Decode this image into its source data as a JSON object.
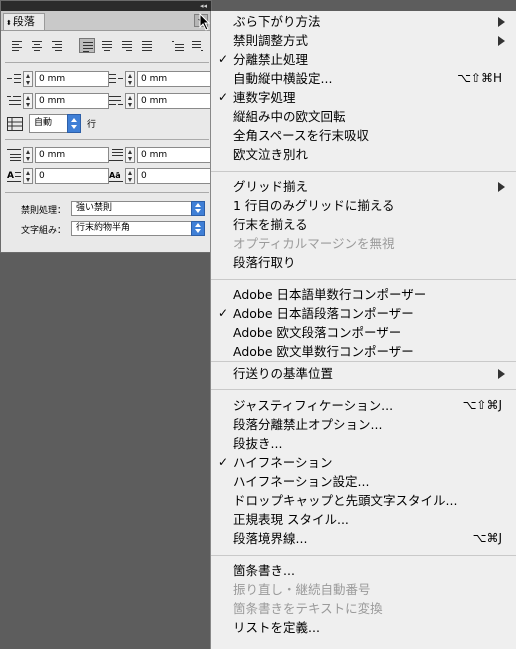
{
  "panel": {
    "tab_label": "段落",
    "fields": {
      "left_indent": "0 mm",
      "right_indent": "0 mm",
      "first_line_indent": "0 mm",
      "last_line_indent": "0 mm",
      "space_before": "0 mm",
      "space_after": "0 mm",
      "drop_cap_lines": "0",
      "drop_cap_chars": "0"
    },
    "auto_value": "自動",
    "auto_unit": "行",
    "kinsoku_label": "禁則処理：",
    "kinsoku_value": "強い禁則",
    "mojikumi_label": "文字組み：",
    "mojikumi_value": "行末約物半角"
  },
  "menu": {
    "items": [
      {
        "label": "ぶら下がり方法",
        "submenu": true
      },
      {
        "label": "禁則調整方式",
        "submenu": true
      },
      {
        "label": "分離禁止処理",
        "checked": true
      },
      {
        "label": "自動縦中横設定...",
        "shortcut": "⌥⇧⌘H"
      },
      {
        "label": "連数字処理",
        "checked": true
      },
      {
        "label": "縦組み中の欧文回転"
      },
      {
        "label": "全角スペースを行末吸収"
      },
      {
        "label": "欧文泣き別れ"
      },
      {
        "label": "グリッド揃え",
        "submenu": true
      },
      {
        "label": "1 行目のみグリッドに揃える"
      },
      {
        "label": "行末を揃える"
      },
      {
        "label": "オプティカルマージンを無視",
        "disabled": true
      },
      {
        "label": "段落行取り"
      },
      {
        "label": "Adobe 日本語単数行コンポーザー"
      },
      {
        "label": "Adobe 日本語段落コンポーザー",
        "checked": true
      },
      {
        "label": "Adobe 欧文段落コンポーザー"
      },
      {
        "label": "Adobe 欧文単数行コンポーザー"
      },
      {
        "label": "行送りの基準位置",
        "submenu": true
      },
      {
        "label": "ジャスティフィケーション...",
        "shortcut": "⌥⇧⌘J"
      },
      {
        "label": "段落分離禁止オプション..."
      },
      {
        "label": "段抜き..."
      },
      {
        "label": "ハイフネーション",
        "checked": true
      },
      {
        "label": "ハイフネーション設定..."
      },
      {
        "label": "ドロップキャップと先頭文字スタイル..."
      },
      {
        "label": "正規表現 スタイル..."
      },
      {
        "label": "段落境界線...",
        "shortcut": "⌥⌘J"
      },
      {
        "label": "箇条書き..."
      },
      {
        "label": "振り直し・継続自動番号",
        "disabled": true
      },
      {
        "label": "箇条書きをテキストに変換",
        "disabled": true
      },
      {
        "label": "リストを定義..."
      }
    ]
  }
}
